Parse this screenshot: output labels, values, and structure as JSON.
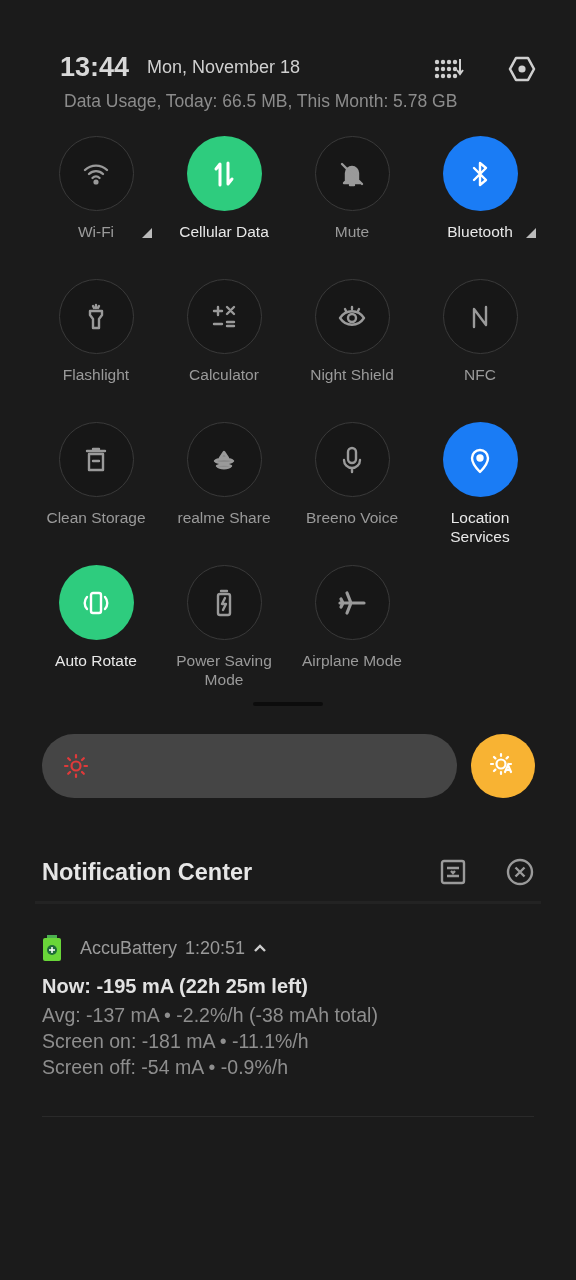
{
  "header": {
    "time": "13:44",
    "date": "Mon, November 18",
    "data_usage": "Data Usage, Today: 66.5 MB, This Month: 5.78 GB"
  },
  "tiles": [
    {
      "label": "Wi-Fi",
      "on": false,
      "has_menu": true
    },
    {
      "label": "Cellular Data",
      "on": true,
      "color": "#2ecc7e",
      "has_menu": false
    },
    {
      "label": "Mute",
      "on": false,
      "has_menu": false
    },
    {
      "label": "Bluetooth",
      "on": true,
      "color": "#1a7cf5",
      "has_menu": true
    },
    {
      "label": "Flashlight",
      "on": false,
      "has_menu": false
    },
    {
      "label": "Calculator",
      "on": false,
      "has_menu": false
    },
    {
      "label": "Night Shield",
      "on": false,
      "has_menu": false
    },
    {
      "label": "NFC",
      "on": false,
      "has_menu": false
    },
    {
      "label": "Clean Storage",
      "on": false,
      "has_menu": false
    },
    {
      "label": "realme Share",
      "on": false,
      "has_menu": false
    },
    {
      "label": "Breeno Voice",
      "on": false,
      "has_menu": false
    },
    {
      "label": "Location Services",
      "on": true,
      "color": "#1a7cf5",
      "has_menu": false
    },
    {
      "label": "Auto Rotate",
      "on": true,
      "color": "#2ecc7e",
      "has_menu": false
    },
    {
      "label": "Power Saving Mode",
      "on": false,
      "has_menu": false
    },
    {
      "label": "Airplane Mode",
      "on": false,
      "has_menu": false
    }
  ],
  "brightness": {
    "auto": true
  },
  "notification_center": {
    "title": "Notification Center"
  },
  "notifications": [
    {
      "app": "AccuBattery",
      "time": "1:20:51",
      "expanded": true,
      "title": "Now: -195 mA (22h 25m left)",
      "lines": [
        "Avg: -137 mA • -2.2%/h (-38 mAh total)",
        "Screen on: -181 mA • -11.1%/h",
        "Screen off: -54 mA • -0.9%/h"
      ]
    }
  ]
}
